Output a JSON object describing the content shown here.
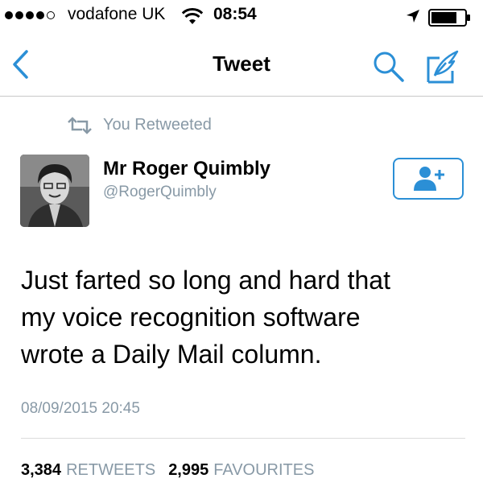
{
  "status_bar": {
    "carrier": "vodafone UK",
    "time": "08:54",
    "signal_bars": 5,
    "signal_filled": 4
  },
  "nav": {
    "title": "Tweet",
    "icons": {
      "back": "chevron-left-icon",
      "search": "search-icon",
      "compose": "compose-icon"
    }
  },
  "retweet_context": {
    "label": "You Retweeted"
  },
  "author": {
    "name": "Mr Roger Quimbly",
    "handle": "@RogerQuimbly"
  },
  "tweet": {
    "lines": [
      "Just farted so long and hard that",
      "my voice recognition software",
      "wrote a Daily Mail column."
    ],
    "timestamp": "08/09/2015 20:45"
  },
  "stats": {
    "retweets_count": "3,384",
    "retweets_label": "RETWEETS",
    "favourites_count": "2,995",
    "favourites_label": "FAVOURITES"
  },
  "colors": {
    "accent": "#2b8fd6",
    "muted": "#8899a6"
  }
}
